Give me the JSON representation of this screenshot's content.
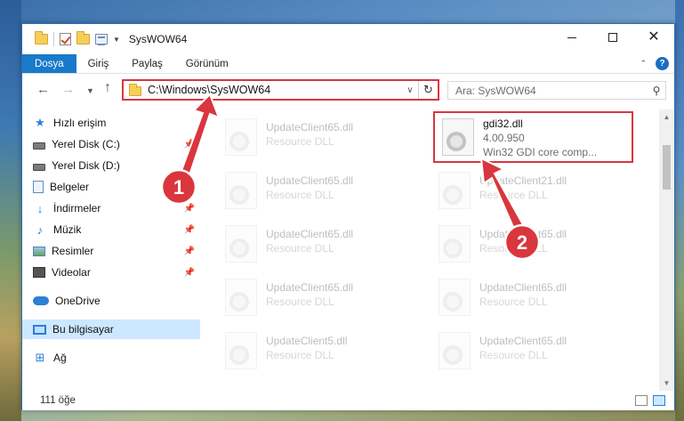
{
  "window": {
    "title": "SysWOW64"
  },
  "ribbon": {
    "tabs": [
      "Dosya",
      "Giriş",
      "Paylaş",
      "Görünüm"
    ]
  },
  "address": {
    "path": "C:\\Windows\\SysWOW64"
  },
  "search": {
    "placeholder": "Ara: SysWOW64"
  },
  "sidebar": {
    "items": [
      {
        "label": "Hızlı erişim",
        "icon": "star-icon"
      },
      {
        "label": "Yerel Disk (C:)",
        "icon": "drive-icon"
      },
      {
        "label": "Yerel Disk (D:)",
        "icon": "drive-icon"
      },
      {
        "label": "Belgeler",
        "icon": "documents-icon"
      },
      {
        "label": "İndirmeler",
        "icon": "download-icon"
      },
      {
        "label": "Müzik",
        "icon": "music-icon"
      },
      {
        "label": "Resimler",
        "icon": "pictures-icon"
      },
      {
        "label": "Videolar",
        "icon": "videos-icon"
      },
      {
        "label": "OneDrive",
        "icon": "cloud-icon"
      },
      {
        "label": "Bu bilgisayar",
        "icon": "computer-icon"
      },
      {
        "label": "Ağ",
        "icon": "network-icon"
      }
    ]
  },
  "files": {
    "highlighted": {
      "name": "gdi32.dll",
      "version": "4.00.950",
      "description": "Win32 GDI core comp..."
    },
    "left": [
      {
        "name": "UpdateClient65.dll",
        "type": "Resource DLL"
      },
      {
        "name": "UpdateClient65.dll",
        "type": "Resource DLL"
      },
      {
        "name": "UpdateClient65.dll",
        "type": "Resource DLL"
      },
      {
        "name": "UpdateClient65.dll",
        "type": "Resource DLL"
      },
      {
        "name": "UpdateClient5.dll",
        "type": "Resource DLL"
      }
    ],
    "right": [
      {
        "name": "UpdateClient21.dll",
        "type": "Resource DLL"
      },
      {
        "name": "UpdateClient65.dll",
        "type": "Resource DLL"
      },
      {
        "name": "UpdateClient65.dll",
        "type": "Resource DLL"
      },
      {
        "name": "UpdateClient65.dll",
        "type": "Resource DLL"
      }
    ]
  },
  "status": {
    "count": "111 öğe"
  },
  "annotations": {
    "marker1": "1",
    "marker2": "2",
    "color": "#d9363e"
  }
}
